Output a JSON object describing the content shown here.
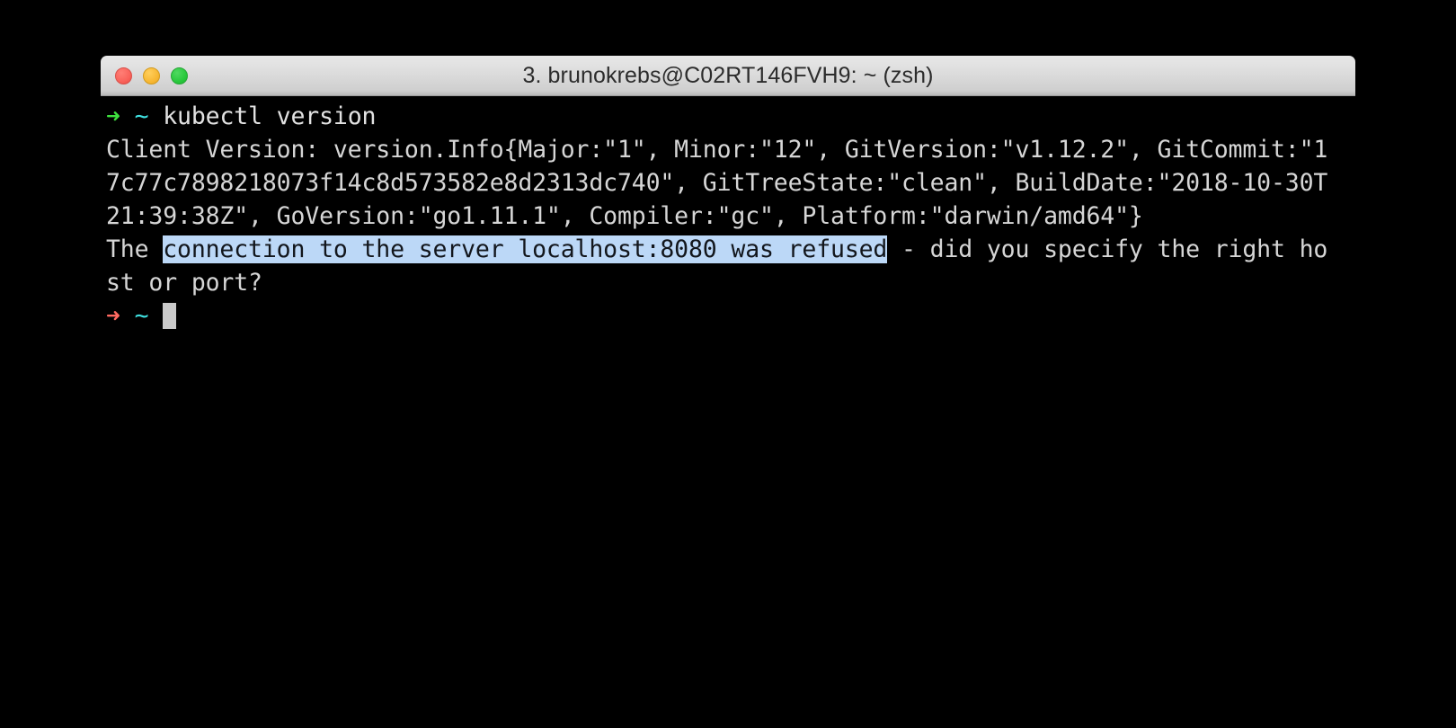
{
  "window": {
    "title": "3. brunokrebs@C02RT146FVH9: ~ (zsh)",
    "traffic_lights": {
      "close": "close-button",
      "minimize": "minimize-button",
      "maximize": "maximize-button"
    }
  },
  "colors": {
    "background": "#000000",
    "text": "#d6d6d6",
    "prompt_arrow_active": "#3ee03e",
    "prompt_arrow_error": "#ff6a61",
    "prompt_tilde": "#3fe0e0",
    "selection_background": "#bcd8f7",
    "selection_text": "#12161c",
    "cursor": "#cacaca",
    "titlebar_text": "#2c2c2c"
  },
  "terminal": {
    "command_line": {
      "arrow": "➜",
      "tilde": "~",
      "command": "kubectl version"
    },
    "output_lines": [
      "Client Version: version.Info{Major:\"1\", Minor:\"12\", GitVersion:\"v1.12.2\", GitCommit:\"1",
      "7c77c7898218073f14c8d573582e8d2313dc740\", GitTreeState:\"clean\", BuildDate:\"2018-10-30T",
      "21:39:38Z\", GoVersion:\"go1.11.1\", Compiler:\"gc\", Platform:\"darwin/amd64\"}"
    ],
    "error_line": {
      "prefix": "The ",
      "selected": "connection to the server localhost:8080 was refused",
      "suffix": " - did you specify the right ho",
      "wrapped": "st or port?"
    },
    "final_prompt": {
      "arrow": "➜",
      "tilde": "~"
    }
  }
}
